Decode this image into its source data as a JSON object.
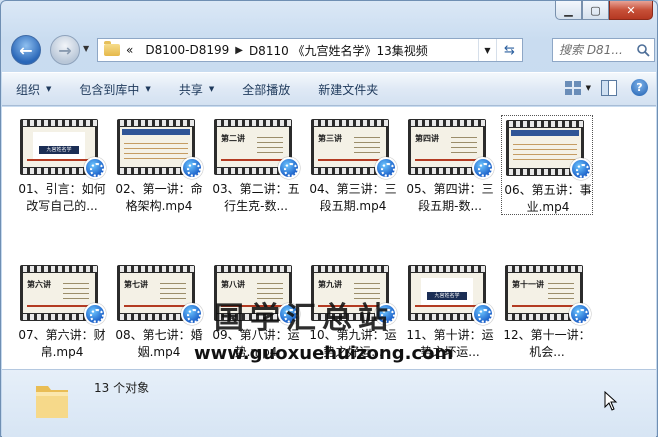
{
  "address": {
    "overflow": "«",
    "crumbs": [
      "D8100-D8199",
      "D8110 《九宫姓名学》13集视频"
    ]
  },
  "search": {
    "placeholder": "搜索 D81..."
  },
  "toolbar": {
    "organize": "组织",
    "include_in_library": "包含到库中",
    "share": "共享",
    "play_all": "全部播放",
    "new_folder": "新建文件夹"
  },
  "files": [
    {
      "name": "01、引言：如何改写自己的...",
      "thumb": "cover",
      "thumb_text": "九宫姓名学"
    },
    {
      "name": "02、第一讲：命格架构.mp4",
      "thumb": "slide",
      "thumb_text": ""
    },
    {
      "name": "03、第二讲：五行生克-数...",
      "thumb": "lecture",
      "thumb_text": "第二讲"
    },
    {
      "name": "04、第三讲：三段五期.mp4",
      "thumb": "lecture",
      "thumb_text": "第三讲"
    },
    {
      "name": "05、第四讲：三段五期-数...",
      "thumb": "lecture",
      "thumb_text": "第四讲"
    },
    {
      "name": "06、第五讲：事业.mp4",
      "thumb": "slide",
      "thumb_text": "",
      "selected": true
    },
    {
      "name": "07、第六讲：财帛.mp4",
      "thumb": "lecture",
      "thumb_text": "第六讲"
    },
    {
      "name": "08、第七讲：婚姻.mp4",
      "thumb": "lecture",
      "thumb_text": "第七讲"
    },
    {
      "name": "09、第八讲：运势.mp4",
      "thumb": "lecture",
      "thumb_text": "第八讲"
    },
    {
      "name": "10、第九讲：运势之好运...",
      "thumb": "lecture",
      "thumb_text": "第九讲"
    },
    {
      "name": "11、第十讲：运势之坏运...",
      "thumb": "cover",
      "thumb_text": "九宫姓名学"
    },
    {
      "name": "12、第十一讲：机会...",
      "thumb": "lecture",
      "thumb_text": "第十一讲"
    }
  ],
  "watermark": {
    "title": "国学汇总站",
    "url": "www.guoxuehuizong.com"
  },
  "status": {
    "count": "13 个对象"
  }
}
